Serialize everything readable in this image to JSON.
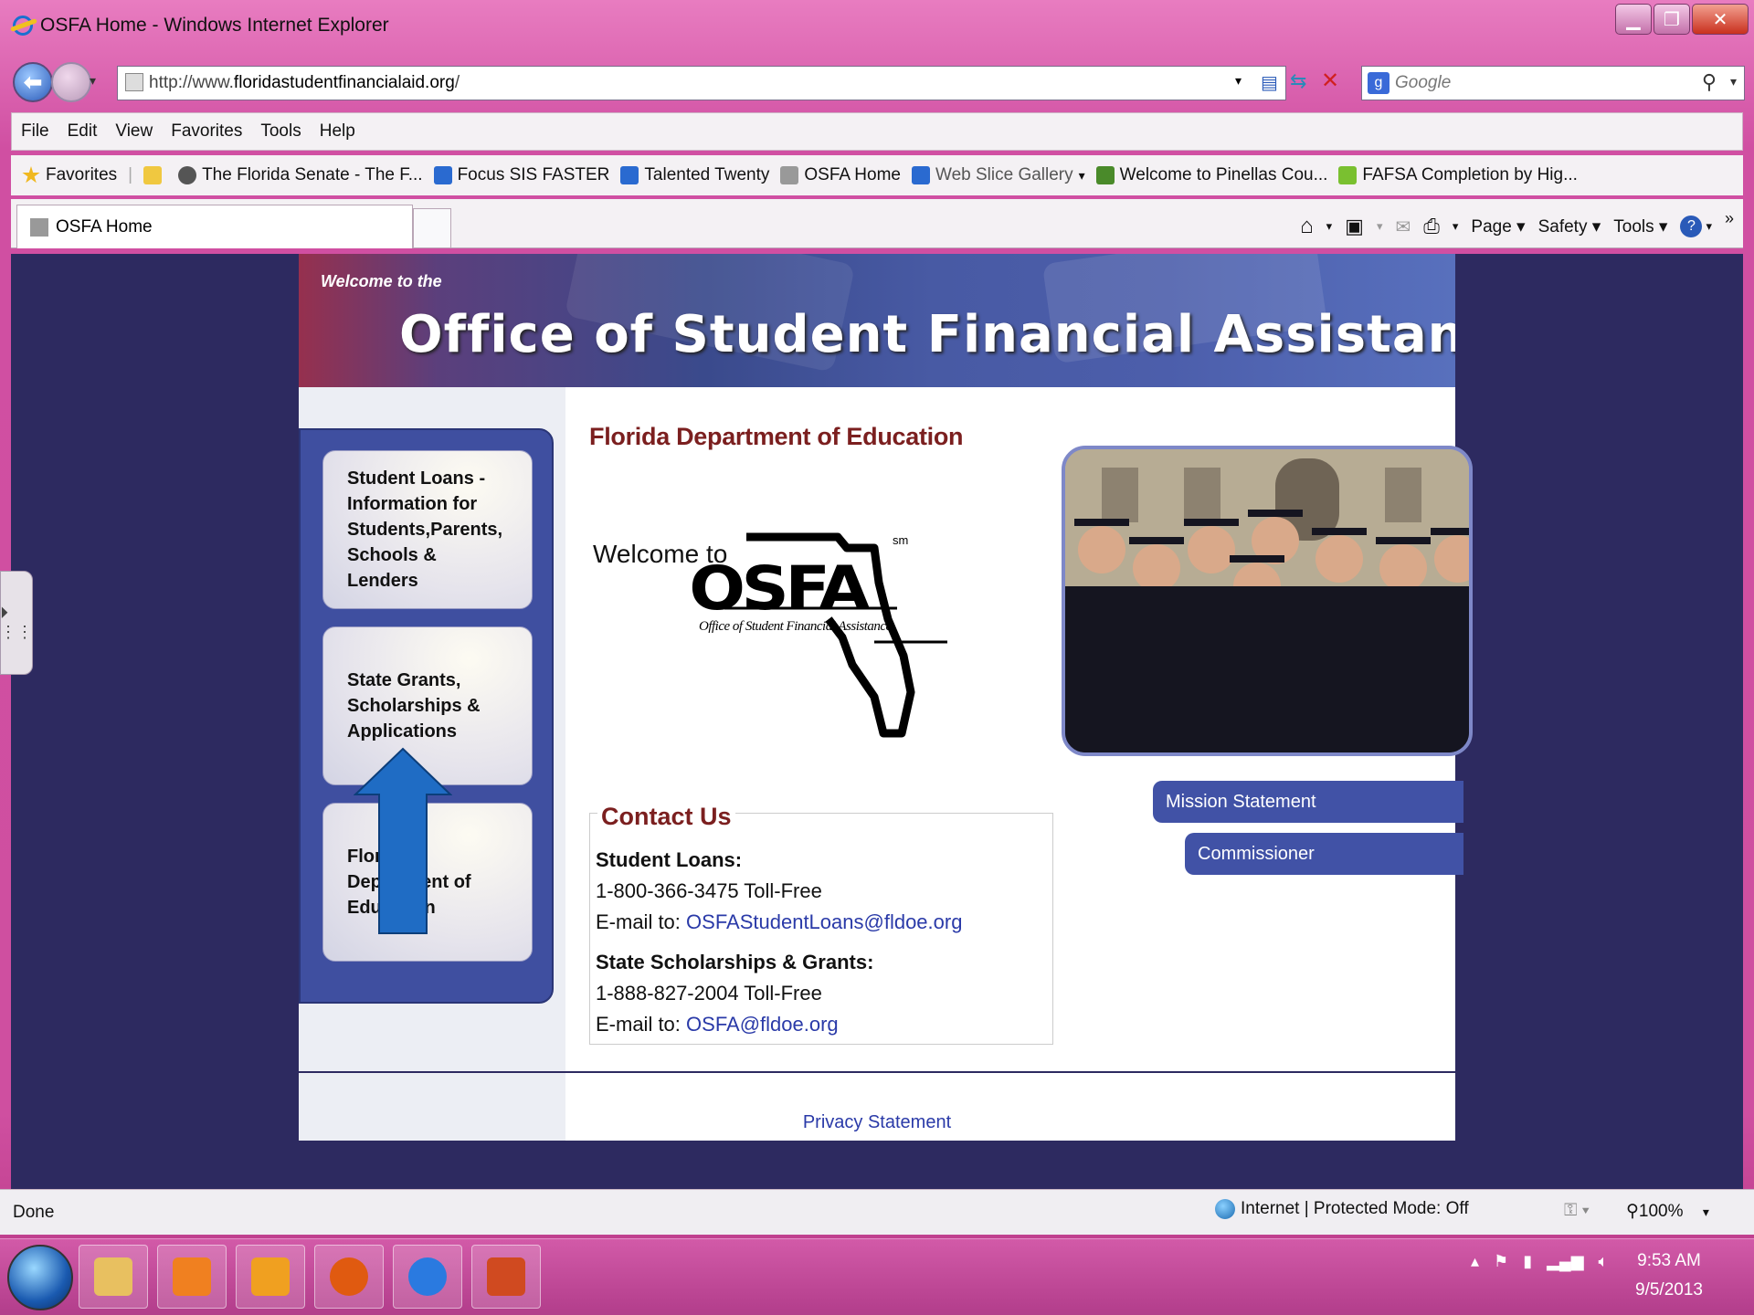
{
  "window": {
    "title": "OSFA Home - Windows Internet Explorer",
    "min_icon": "minimize-icon",
    "max_icon": "maximize-icon",
    "close_icon": "close-icon"
  },
  "address_bar": {
    "url_prefix": "http://www.",
    "url_domain": "floridastudentfinancialaid.org",
    "url_suffix": "/"
  },
  "search": {
    "placeholder": "Google"
  },
  "menu": [
    "File",
    "Edit",
    "View",
    "Favorites",
    "Tools",
    "Help"
  ],
  "favorites": {
    "label": "Favorites",
    "items": [
      {
        "label": "The Florida Senate - The F...",
        "color": "#555555"
      },
      {
        "label": "Focus SIS FASTER",
        "color": "#2a6ad0"
      },
      {
        "label": "Talented Twenty",
        "color": "#2a6ad0"
      },
      {
        "label": "OSFA Home",
        "color": "#666666"
      },
      {
        "label": "Web Slice Gallery",
        "color": "#2a6ad0",
        "dropdown": "▾"
      },
      {
        "label": "Welcome to Pinellas Cou...",
        "color": "#4a8a2a"
      },
      {
        "label": "FAFSA Completion by Hig...",
        "color": "#7ac030"
      }
    ]
  },
  "tabs": [
    {
      "label": "OSFA Home",
      "active": true
    }
  ],
  "command_bar": {
    "page": "Page ▾",
    "safety": "Safety ▾",
    "tools": "Tools ▾",
    "overflow": "»"
  },
  "page": {
    "banner_welcome": "Welcome to the",
    "banner_title": "Office of Student Financial Assistance",
    "dept_heading": "Florida Department of Education",
    "welcome_to": "Welcome to",
    "logo_text": "OSFA",
    "logo_sm": "sm",
    "logo_tagline": "Office of Student Financial Assistance",
    "left_nav": [
      "Student Loans - Information for Students,Parents, Schools & Lenders",
      "State Grants, Scholarships & Applications",
      "Florida Department of Education"
    ],
    "right_nav": [
      "Mission Statement",
      "Commissioner"
    ],
    "contact": {
      "heading": "Contact Us",
      "loans_label": "Student Loans:",
      "loans_phone": "1-800-366-3475 Toll-Free",
      "email_prefix": "E-mail to: ",
      "loans_email": "OSFAStudentLoans@fldoe.org",
      "grants_label": "State Scholarships & Grants:",
      "grants_phone": "1-888-827-2004 Toll-Free",
      "grants_email": "OSFA@fldoe.org"
    },
    "privacy": "Privacy Statement"
  },
  "status_bar": {
    "left": "Done",
    "zone": "Internet | Protected Mode: Off",
    "zoom": "100%"
  },
  "taskbar": {
    "apps": [
      {
        "name": "explorer",
        "color": "#e8c060"
      },
      {
        "name": "media-player",
        "color": "#f08020"
      },
      {
        "name": "outlook",
        "color": "#f0a020"
      },
      {
        "name": "firefox",
        "color": "#e05a10"
      },
      {
        "name": "internet-explorer",
        "color": "#2a7ae0"
      },
      {
        "name": "powerpoint",
        "color": "#d04a20"
      }
    ],
    "time": "9:53 AM",
    "date": "9/5/2013"
  }
}
